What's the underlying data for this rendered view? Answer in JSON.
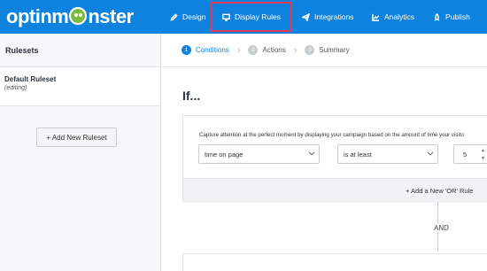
{
  "brand": {
    "logo_pre": "optinm",
    "logo_post": "nster",
    "color": "#0d82df"
  },
  "nav": {
    "design": {
      "label": "Design",
      "icon": "pencil-icon"
    },
    "display_rules": {
      "label": "Display Rules",
      "icon": "monitor-icon",
      "highlight": "#e63757"
    },
    "integrations": {
      "label": "Integrations",
      "icon": "paper-plane-icon"
    },
    "analytics": {
      "label": "Analytics",
      "icon": "line-chart-icon"
    },
    "publish": {
      "label": "Publish",
      "icon": "rocket-icon"
    }
  },
  "sidebar": {
    "header": "Rulesets",
    "ruleset": {
      "name": "Default Ruleset",
      "state": "(editing)"
    },
    "add_button": "+ Add New Ruleset"
  },
  "steps": [
    {
      "num": "1",
      "label": "Conditions",
      "active": true
    },
    {
      "num": "2",
      "label": "Actions",
      "active": false
    },
    {
      "num": "3",
      "label": "Summary",
      "active": false
    }
  ],
  "main": {
    "title": "If...",
    "rule": {
      "description": "Capture attention at the perfect moment by displaying your campaign based on the amount of time your visito",
      "condition": "time on page",
      "operator": "is at least",
      "value": "5"
    },
    "or_button": "+ Add a New 'OR' Rule",
    "and_label": "AND"
  }
}
